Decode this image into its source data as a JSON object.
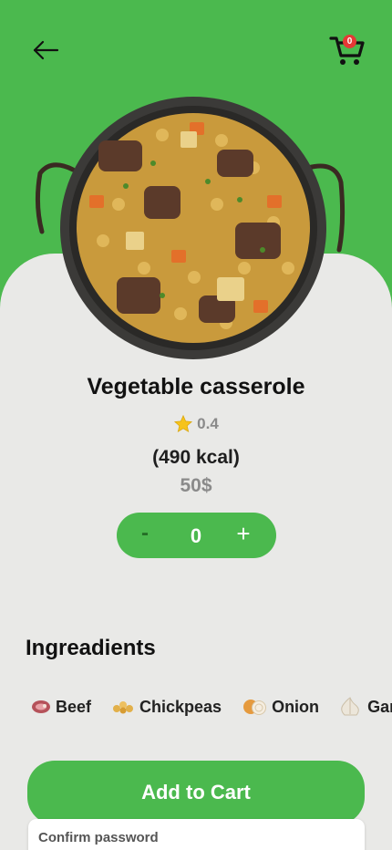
{
  "header": {
    "back_icon": "arrow-left-icon",
    "cart_icon": "shopping-cart-icon",
    "cart_count": "0"
  },
  "colors": {
    "accent": "#4bb94e",
    "sheet_bg": "#e9e9e7",
    "badge": "#e53935",
    "star": "#f6c31b"
  },
  "product": {
    "name": "Vegetable casserole",
    "rating": "0.4",
    "rating_icon": "star-icon",
    "calories": "(490 kcal)",
    "price": "50$"
  },
  "quantity": {
    "minus_label": "-",
    "value": "0",
    "plus_label": "+"
  },
  "ingredients": {
    "title": "Ingreadients",
    "items": [
      {
        "icon": "beef-icon",
        "label": "Beef"
      },
      {
        "icon": "chickpeas-icon",
        "label": "Chickpeas"
      },
      {
        "icon": "onion-icon",
        "label": "Onion"
      },
      {
        "icon": "garlic-icon",
        "label": "Garlic"
      }
    ]
  },
  "actions": {
    "add_to_cart_label": "Add to Cart"
  },
  "overlay_field": {
    "label": "Confirm password"
  }
}
